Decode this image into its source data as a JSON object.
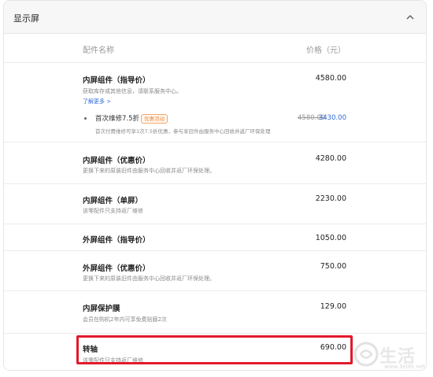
{
  "section": {
    "title": "显示屏",
    "collapse_icon": "chevron-up-icon"
  },
  "columns": {
    "name": "配件名称",
    "price": "价格（元）"
  },
  "items": [
    {
      "title": "内屏组件（指导价）",
      "price": "4580.00",
      "desc": "获取库存或其他信息，请联系服务中心。",
      "more": "了解更多 >",
      "promo": {
        "title": "首次维修7.5折",
        "badge": "优惠活动",
        "desc": "首次付费维修可享1次7.5折优惠，参与享旧件由服务中心回收并返厂环保处理",
        "old_price": "4580.00",
        "new_price": "3430.00"
      }
    },
    {
      "title": "内屏组件（优惠价）",
      "price": "4280.00",
      "desc": "更换下来的原装旧件由服务中心回收并返厂环保处理。"
    },
    {
      "title": "内屏组件（单屏）",
      "price": "2230.00",
      "desc": "该零配件只支持返厂维修"
    },
    {
      "title": "外屏组件（指导价）",
      "price": "1050.00",
      "desc": ""
    },
    {
      "title": "外屏组件（优惠价）",
      "price": "750.00",
      "desc": "更换下来的原装旧件由服务中心回收并返厂环保处理。"
    },
    {
      "title": "内屏保护膜",
      "price": "129.00",
      "desc": "会员在购机2年内可享免费贴膜2次"
    },
    {
      "title": "转轴",
      "price": "690.00",
      "desc": "该零配件只支持返厂维修"
    }
  ],
  "watermark": {
    "text": "生活",
    "url": "www.3elife.net",
    "colors": {
      "highlight": "#e21a2a",
      "link": "#2d6ad8",
      "badge": "#f08a3c"
    }
  }
}
